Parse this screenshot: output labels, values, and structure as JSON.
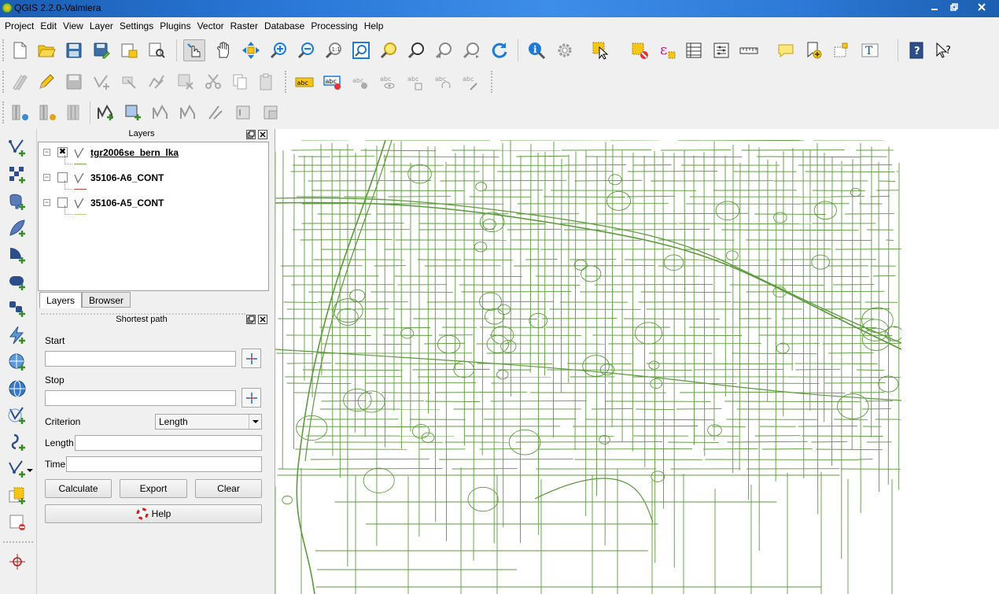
{
  "window": {
    "title": "QGIS 2.2.0-Valmiera"
  },
  "menu": [
    "Project",
    "Edit",
    "View",
    "Layer",
    "Settings",
    "Plugins",
    "Vector",
    "Raster",
    "Database",
    "Processing",
    "Help"
  ],
  "labels_toolbar": {
    "abc": "abc"
  },
  "layers_panel": {
    "title": "Layers",
    "layers": [
      {
        "name": "tgr2006se_bern_lka",
        "checked": true,
        "checkmark": "✖",
        "legend_color": "#7aa84a",
        "active": true
      },
      {
        "name": "35106-A6_CONT",
        "checked": false,
        "checkmark": "",
        "legend_color": "#b04a3a",
        "active": false
      },
      {
        "name": "35106-A5_CONT",
        "checked": false,
        "checkmark": "",
        "legend_color": "#c8c87a",
        "active": false
      }
    ],
    "tabs": [
      "Layers",
      "Browser"
    ]
  },
  "shortest_path": {
    "title": "Shortest path",
    "start_label": "Start",
    "start_value": "",
    "stop_label": "Stop",
    "stop_value": "",
    "criterion_label": "Criterion",
    "criterion_value": "Length",
    "length_label": "Length",
    "length_value": "",
    "time_label": "Time",
    "time_value": "",
    "calculate_label": "Calculate",
    "export_label": "Export",
    "clear_label": "Clear",
    "help_label": "Help"
  },
  "map": {
    "road_color": "#5c9a3c",
    "background": "#ffffff"
  },
  "colors": {
    "titlebar": "#2a78d8",
    "panel_bg": "#f0f0f0",
    "accent_yellow": "#f5c518"
  }
}
